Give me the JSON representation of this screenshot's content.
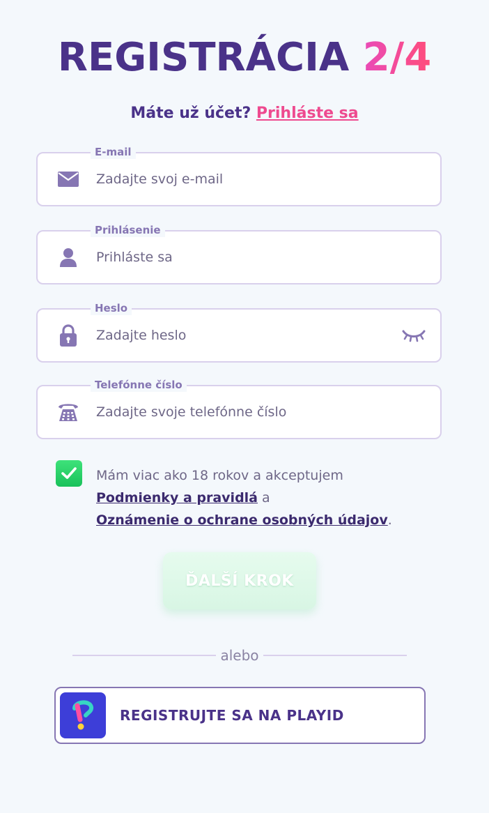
{
  "header": {
    "title": "REGISTRÁCIA",
    "step": "2/4"
  },
  "account": {
    "question": "Máte už účet?",
    "login_link": "Prihláste sa"
  },
  "fields": {
    "email": {
      "label": "E-mail",
      "placeholder": "Zadajte svoj e-mail",
      "icon": "envelope-icon"
    },
    "login": {
      "label": "Prihlásenie",
      "placeholder": "Prihláste sa",
      "icon": "user-icon"
    },
    "password": {
      "label": "Heslo",
      "placeholder": "Zadajte heslo",
      "icon": "lock-icon",
      "toggle_icon": "eye-closed-icon"
    },
    "phone": {
      "label": "Telefónne číslo",
      "placeholder": "Zadajte svoje telefónne číslo",
      "icon": "telephone-icon"
    }
  },
  "consent": {
    "checked": true,
    "text_before": "Mám viac ako 18 rokov a akceptujem",
    "terms_link": "Podmienky a pravidlá",
    "conjunction": "a",
    "privacy_link": "Oznámenie o ochrane osobných údajov",
    "end": "."
  },
  "actions": {
    "next_label": "ĎALŠÍ KROK",
    "divider_text": "alebo",
    "playid_label": "REGISTRUJTE SA NA PLAYID"
  },
  "colors": {
    "primary": "#4a3289",
    "accent_pink": "#ee4a8f",
    "field_border": "#d9d0ec",
    "icon": "#8676b3",
    "checkbox": "#22cc66",
    "next_button": "#e0f8ea",
    "playid_logo_bg": "#3d3ed8",
    "background": "#f4f8fc"
  }
}
